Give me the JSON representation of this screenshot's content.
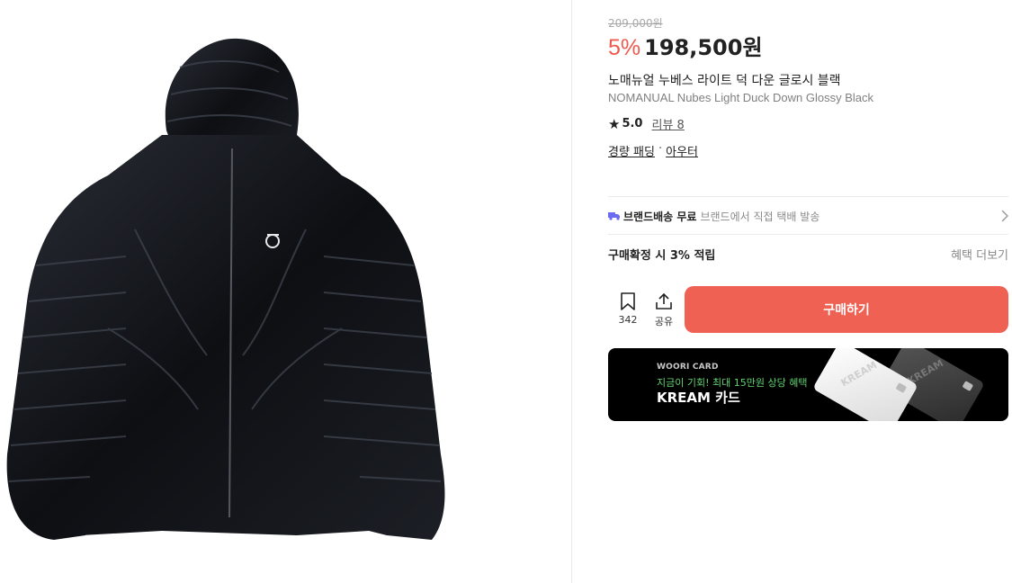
{
  "product": {
    "original_price": "209,000원",
    "discount": "5%",
    "price": "198,500원",
    "name_ko": "노매뉴얼 누베스 라이트 덕 다운 글로시 블랙",
    "name_en": "NOMANUAL Nubes Light Duck Down Glossy Black",
    "rating": "5.0",
    "review_label": "리뷰 8",
    "categories": [
      "경량 패딩",
      "아우터"
    ],
    "category_separator": "·"
  },
  "shipping": {
    "title": "브랜드배송 무료",
    "desc": "브랜드에서 직접 택배 발송",
    "icon": "truck-icon",
    "accent": "#6c6cf0"
  },
  "points": {
    "label": "구매확정 시 3% 적립",
    "more": "혜택 더보기"
  },
  "actions": {
    "bookmark_count": "342",
    "share_label": "공유",
    "buy_label": "구매하기",
    "buy_color": "#ef6253"
  },
  "banner": {
    "brand": "WOORI CARD",
    "promo": "지금이 기회! 최대 15만원 상당 혜택",
    "title": "KREAM 카드",
    "card_text": "KREAM",
    "promo_color": "#61d470"
  }
}
